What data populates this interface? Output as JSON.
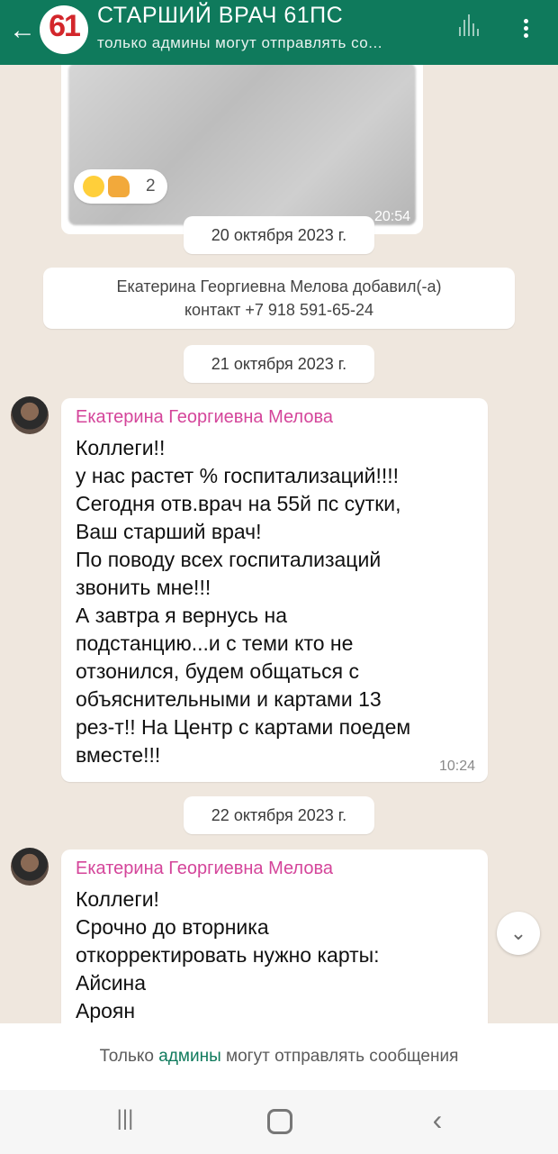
{
  "header": {
    "title": "СТАРШИЙ ВРАЧ 61ПС",
    "subtitle": "только админы могут отправлять со...",
    "group_avatar_text": "61",
    "back_icon": "arrow-left-icon",
    "voice_icon": "audio-wave-icon",
    "menu_icon": "more-vertical-icon"
  },
  "image_message": {
    "time": "20:54"
  },
  "reactions": {
    "count": "2",
    "emojis": [
      "smiling-face-icon",
      "thumbs-up-icon"
    ]
  },
  "dates": [
    "20 октября 2023 г.",
    "21 октября 2023 г.",
    "22 октября 2023 г."
  ],
  "system_message": {
    "line1": "Екатерина Георгиевна Мелова добавил(-а)",
    "line2": "контакт +7 918 591-65-24"
  },
  "messages": [
    {
      "author": "Екатерина Георгиевна Мелова",
      "text": "Коллеги!!\nу нас растет % госпитализаций!!!!\nСегодня отв.врач на 55й пс сутки,\nВаш старший врач!\nПо поводу всех госпитализаций\nзвонить мне!!!\nА завтра я вернусь на\nподстанцию...и с теми кто не\nотзонился, будем общаться с\nобъяснительными и картами 13\nрез-т!! На Центр с картами поедем\nвместе!!!",
      "time": "10:24"
    },
    {
      "author": "Екатерина Георгиевна Мелова",
      "text": "Коллеги!\nСрочно до вторника\nоткорректировать нужно карты:\nАйсина\nАроян"
    }
  ],
  "footer": {
    "prefix": "Только ",
    "admins": "админы",
    "suffix": " могут отправлять сообщения"
  },
  "colors": {
    "header": "#0f7a5c",
    "author": "#d4459a",
    "background": "#efe7de"
  }
}
